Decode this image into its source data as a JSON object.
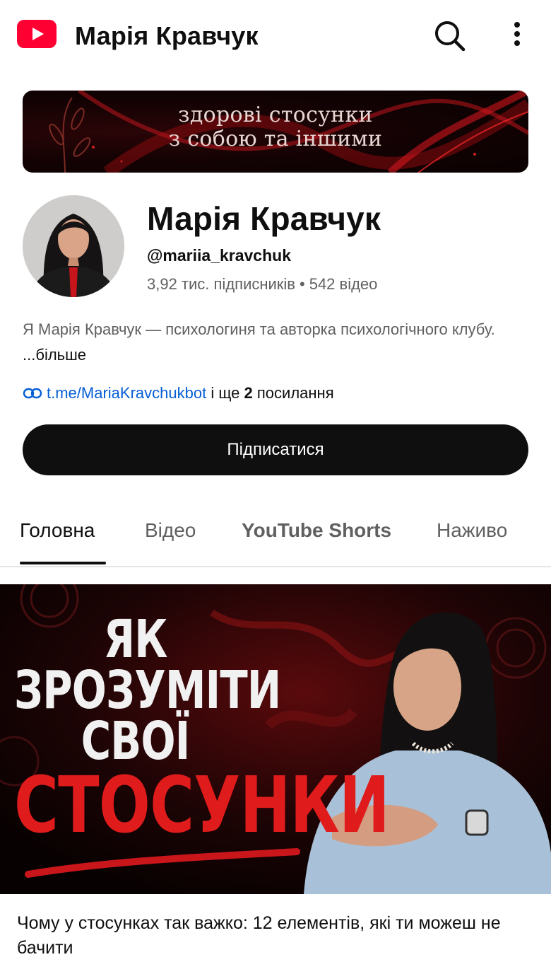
{
  "topbar": {
    "channel_title": "Марія Кравчук",
    "logo_icon": "youtube-logo-icon",
    "search_icon": "search-icon",
    "more_icon": "more-vertical-icon",
    "brand_red": "#ff0000"
  },
  "banner": {
    "line1": "здорові стосунки",
    "line2": "з собою та іншими"
  },
  "profile": {
    "name": "Марія Кравчук",
    "handle": "@mariia_kravchuk",
    "subscribers": "3,92 тис. підписників",
    "separator": "•",
    "videos": "542 відео",
    "description": "Я Марія Кравчук — психологиня та авторка психологічного клубу.",
    "more_label": "...більше",
    "link_text": "t.me/MariaKravchukbot",
    "link_suffix_pre": " і ще ",
    "link_count": "2",
    "link_suffix_post": " посилання",
    "link_color": "#065fd4"
  },
  "subscribe": {
    "label": "Підписатися"
  },
  "tabs": [
    {
      "label": "Головна",
      "active": true
    },
    {
      "label": "Відео",
      "active": false
    },
    {
      "label": "YouTube Shorts",
      "active": false
    },
    {
      "label": "Наживо",
      "active": false
    }
  ],
  "video": {
    "thumb_line1": "ЯК",
    "thumb_line2": "ЗРОЗУМІТИ",
    "thumb_line3": "СВОЇ",
    "thumb_line4": "СТОСУНКИ",
    "title": "Чому у стосунках так важко: 12 елементів, які ти можеш не бачити"
  }
}
